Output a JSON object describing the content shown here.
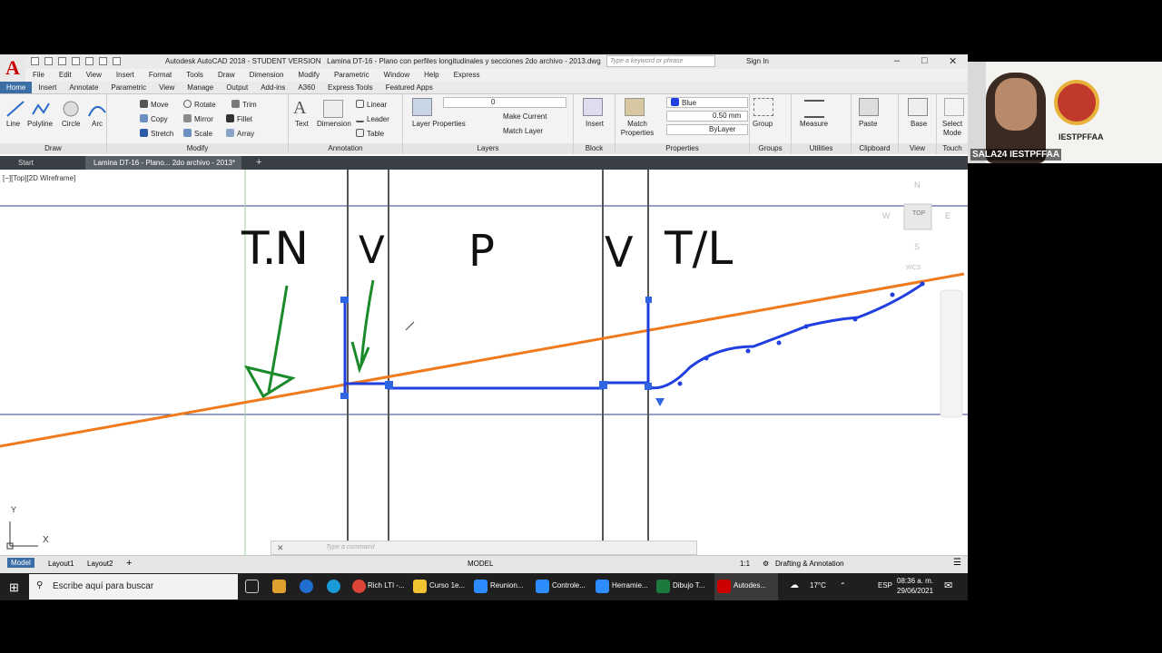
{
  "title_bar": {
    "app_title": "Autodesk AutoCAD 2018 - STUDENT VERSION",
    "file_title": "Lamina DT-16 - Plano con perfiles longitudinales y secciones 2do archivo - 2013.dwg",
    "search_placeholder": "Type a keyword or phrase",
    "sign_in": "Sign In"
  },
  "menu": [
    "File",
    "Edit",
    "View",
    "Insert",
    "Format",
    "Tools",
    "Draw",
    "Dimension",
    "Modify",
    "Parametric",
    "Window",
    "Help",
    "Express"
  ],
  "ribbon_tabs": [
    "Home",
    "Insert",
    "Annotate",
    "Parametric",
    "View",
    "Manage",
    "Output",
    "Add-ins",
    "A360",
    "Express Tools",
    "Featured Apps"
  ],
  "ribbon": {
    "draw": {
      "title": "Draw",
      "line": "Line",
      "polyline": "Polyline",
      "circle": "Circle",
      "arc": "Arc"
    },
    "modify": {
      "title": "Modify",
      "move": "Move",
      "rotate": "Rotate",
      "trim": "Trim",
      "copy": "Copy",
      "mirror": "Mirror",
      "fillet": "Fillet",
      "stretch": "Stretch",
      "scale": "Scale",
      "array": "Array"
    },
    "annotation": {
      "title": "Annotation",
      "text": "Text",
      "dimension": "Dimension",
      "linear": "Linear",
      "leader": "Leader",
      "table": "Table"
    },
    "layers": {
      "title": "Layers",
      "layer_properties": "Layer Properties",
      "current_layer": "0",
      "make_current": "Make Current",
      "match_layer": "Match Layer"
    },
    "block": {
      "title": "Block",
      "insert": "Insert"
    },
    "properties": {
      "title": "Properties",
      "match_properties": "Match Properties",
      "color": "Blue",
      "lineweight": "0.50 mm",
      "linetype": "ByLayer"
    },
    "groups": {
      "title": "Groups",
      "group": "Group"
    },
    "utilities": {
      "title": "Utilities",
      "measure": "Measure"
    },
    "clipboard": {
      "title": "Clipboard",
      "paste": "Paste"
    },
    "view": {
      "title": "View",
      "base": "Base"
    },
    "touch": {
      "title": "Touch",
      "select_mode": "Select Mode"
    }
  },
  "doc_tabs": {
    "start": "Start",
    "active": "Lamina DT-16 - Plano... 2do archivo - 2013*"
  },
  "viewport_label": "[−][Top][2D Wireframe]",
  "drawing_labels": {
    "tn": "T.N",
    "v1": "V",
    "p": "P",
    "v2": "V",
    "tl": "T/L"
  },
  "viewcube": {
    "top": "TOP",
    "n": "N",
    "s": "S",
    "w": "W",
    "e": "E",
    "wcs": "WCS"
  },
  "ucs": {
    "x": "X",
    "y": "Y"
  },
  "command_placeholder": "Type a command",
  "layout_tabs": [
    "Model",
    "Layout1",
    "Layout2"
  ],
  "status": {
    "model": "MODEL",
    "scale": "1:1",
    "workspace": "Drafting & Annotation"
  },
  "webcam": {
    "name": "SALA24 IESTPFFAA",
    "org": "IESTPFFAA"
  },
  "taskbar": {
    "search": "Escribe aquí para buscar",
    "apps": [
      "Rich LTI -...",
      "Curso 1e...",
      "Reunion...",
      "Controle...",
      "Herramie...",
      "Dibujo T...",
      "Autodes..."
    ],
    "weather": "17°C",
    "lang": "ESP",
    "time": "08:36 a. m.",
    "date": "29/06/2021"
  },
  "colors": {
    "accent": "#3b6ea5",
    "orange_line": "#f07a1e",
    "blue_poly": "#1f3fe0",
    "annotation_green": "#1a8a2a"
  }
}
